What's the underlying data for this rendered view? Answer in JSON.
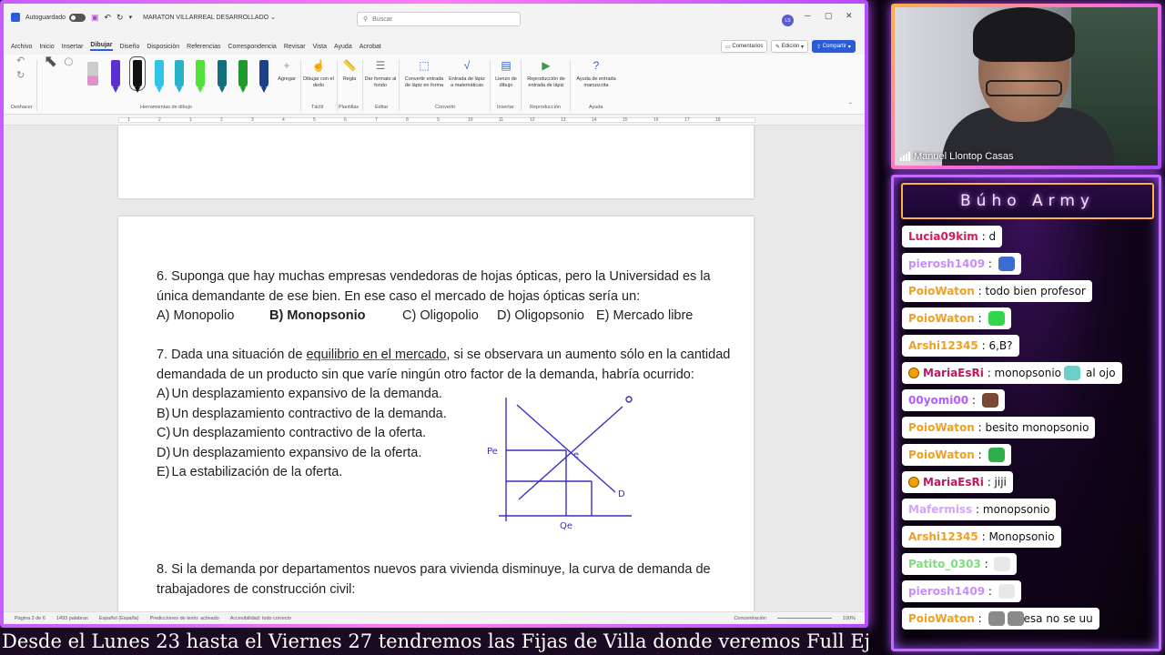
{
  "word": {
    "autosave_label": "Autoguardado",
    "doc_title": "MARATON VILLARREAL DESARROLLADO",
    "search_placeholder": "Buscar",
    "user_initials": "LS",
    "menu": [
      "Archivo",
      "Inicio",
      "Insertar",
      "Dibujar",
      "Diseño",
      "Disposición",
      "Referencias",
      "Correspondencia",
      "Revisar",
      "Vista",
      "Ayuda",
      "Acrobat"
    ],
    "active_menu": "Dibujar",
    "comments_label": "Comentarios",
    "edit_label": "Edición",
    "share_label": "Compartir",
    "ribbon": {
      "undo_group": "Deshacer",
      "drawing_tools_group": "Herramientas de dibujo",
      "add_label": "Agregar",
      "draw_finger": "Dibujar con el dedo",
      "ruler": "Regla",
      "format_bg": "Dar formato al fondo",
      "ink_to_shape": "Convertir entrada de lápiz en forma",
      "ink_to_math": "Entrada de lápiz a matemáticas",
      "canvas": "Lienzo de dibujo",
      "replay": "Reproducción de entrada de lápiz",
      "help_ink": "Ayuda de entrada manuscrita",
      "g_tactil": "Táctil",
      "g_templates": "Plantillas",
      "g_edit": "Editar",
      "g_convert": "Convertir",
      "g_insert": "Insertar",
      "g_replay": "Reproducción",
      "g_help": "Ayuda"
    },
    "ruler_numbers": [
      "1",
      "2",
      "1",
      "2",
      "3",
      "4",
      "5",
      "6",
      "7",
      "8",
      "9",
      "10",
      "11",
      "12",
      "13",
      "14",
      "15",
      "16",
      "17",
      "18"
    ],
    "status": {
      "page": "Página 2 de 6",
      "words": "1493 palabras",
      "lang": "Español (España)",
      "predictions": "Predicciones de texto: activado",
      "accessibility": "Accesibilidad: todo correcto",
      "focus": "Concentración",
      "zoom": "100%"
    }
  },
  "doc": {
    "q6_line1": "6. Suponga que hay muchas empresas vendedoras de hojas ópticas, pero la Universidad es la",
    "q6_line2": "única demandante de ese bien. En ese caso el mercado de hojas ópticas sería un:",
    "q6_options": [
      "A) Monopolio",
      "B) Monopsonio",
      "C) Oligopolio",
      "D) Oligopsonio",
      "E) Mercado libre"
    ],
    "q7_prefix": "7. Dada una situación de ",
    "q7_underlined": "equilibrio en el mercado",
    "q7_suffix": ", si se observara un aumento sólo en la cantidad",
    "q7_line2": "demandada de un producto sin que varíe ningún otro factor de la demanda, habría ocurrido:",
    "q7_options": [
      {
        "letter": "A)",
        "text": "Un desplazamiento expansivo de la demanda."
      },
      {
        "letter": "B)",
        "text": "Un desplazamiento contractivo de la demanda."
      },
      {
        "letter": "C)",
        "text": "Un desplazamiento contractivo de la oferta."
      },
      {
        "letter": "D)",
        "text": "Un desplazamiento expansivo de la oferta."
      },
      {
        "letter": "E)",
        "text": "La estabilización de la oferta."
      }
    ],
    "sketch": {
      "pe": "Pe",
      "e": "e",
      "d": "D",
      "o": "O",
      "qe": "Qe"
    },
    "q8_line1": "8. Si la demanda por departamentos nuevos para vivienda disminuye, la curva de demanda de",
    "q8_line2": "trabajadores de construcción civil:"
  },
  "cam": {
    "name": "Manuel Llontop Casas"
  },
  "chat": {
    "title": "Búho Army",
    "messages": [
      {
        "user": "Lucia09kim",
        "color": "#d81b60",
        "text": "d",
        "badge": false,
        "emotes": []
      },
      {
        "user": "pierosh1409",
        "color": "#c98bff",
        "text": "",
        "badge": false,
        "emotes": [
          "#3c6bd1"
        ]
      },
      {
        "user": "PoioWaton",
        "color": "#f0a020",
        "text": "todo bien profesor",
        "badge": false,
        "emotes": []
      },
      {
        "user": "PoioWaton",
        "color": "#f0a020",
        "text": "",
        "badge": false,
        "emotes": [
          "#33d64a"
        ]
      },
      {
        "user": "Arshi12345",
        "color": "#f0a020",
        "text": "6,B?",
        "badge": false,
        "emotes": []
      },
      {
        "user": "MariaEsRi",
        "color": "#c2185b",
        "text": "monopsonio",
        "text2": "al ojo",
        "badge": true,
        "emotes": [
          "#6ad0c8"
        ]
      },
      {
        "user": "00yomi00",
        "color": "#b45cff",
        "text": "",
        "badge": false,
        "emotes": [
          "#7a4a36"
        ]
      },
      {
        "user": "PoioWaton",
        "color": "#f0a020",
        "text": "besito monopsonio",
        "badge": false,
        "emotes": []
      },
      {
        "user": "PoioWaton",
        "color": "#f0a020",
        "text": "",
        "badge": false,
        "emotes": [
          "#2fae49"
        ]
      },
      {
        "user": "MariaEsRi",
        "color": "#c2185b",
        "text": "jiji",
        "badge": true,
        "emotes": []
      },
      {
        "user": "Mafermiss",
        "color": "#d3a4ff",
        "text": "monopsonio",
        "badge": false,
        "emotes": []
      },
      {
        "user": "Arshi12345",
        "color": "#f0a020",
        "text": "Monopsonio",
        "badge": false,
        "emotes": []
      },
      {
        "user": "Patito_0303",
        "color": "#7be07b",
        "text": "",
        "badge": false,
        "emotes": [
          "#e8e8e8"
        ]
      },
      {
        "user": "pierosh1409",
        "color": "#c98bff",
        "text": "",
        "badge": false,
        "emotes": [
          "#e8e8e8"
        ]
      },
      {
        "user": "PoioWaton",
        "color": "#f0a020",
        "text": "esa no se uu",
        "badge": false,
        "emotes": [
          "#8a8a8a",
          "#8a8a8a"
        ]
      }
    ]
  },
  "ticker": "Desde el Lunes 23 hasta el Viernes 27 tendremos las Fijas de Villa donde veremos Full Ejercicios"
}
